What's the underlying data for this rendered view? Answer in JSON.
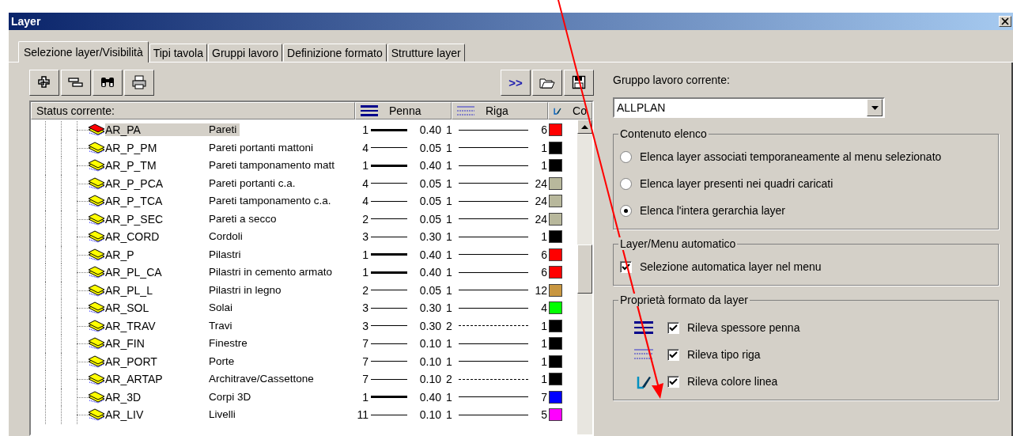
{
  "window": {
    "title": "Layer"
  },
  "tabs": [
    {
      "label": "Selezione layer/Visibilità",
      "selected": true
    },
    {
      "label": "Tipi tavola",
      "selected": false
    },
    {
      "label": "Gruppi lavoro",
      "selected": false
    },
    {
      "label": "Definizione formato",
      "selected": false
    },
    {
      "label": "Strutture layer",
      "selected": false
    }
  ],
  "toolbar_right": {
    "expand_button": ">>"
  },
  "list": {
    "columns": [
      "Status corrente:",
      "Penna",
      "Riga",
      "Co"
    ],
    "rows": [
      {
        "name": "AR_PA",
        "description": "Pareti",
        "pen": "1",
        "thick_pen": true,
        "thickness": "0.40",
        "line": "1",
        "dashed_line": false,
        "color_number": "6",
        "color": "#ff0000",
        "selected": true
      },
      {
        "name": "AR_P_PM",
        "description": "Pareti portanti mattoni",
        "pen": "4",
        "thick_pen": false,
        "thickness": "0.05",
        "line": "1",
        "dashed_line": false,
        "color_number": "1",
        "color": "#000000",
        "selected": false
      },
      {
        "name": "AR_P_TM",
        "description": "Pareti tamponamento matt",
        "pen": "1",
        "thick_pen": true,
        "thickness": "0.40",
        "line": "1",
        "dashed_line": false,
        "color_number": "1",
        "color": "#000000",
        "selected": false
      },
      {
        "name": "AR_P_PCA",
        "description": "Pareti portanti c.a.",
        "pen": "4",
        "thick_pen": false,
        "thickness": "0.05",
        "line": "1",
        "dashed_line": false,
        "color_number": "24",
        "color": "#b8b89c",
        "selected": false
      },
      {
        "name": "AR_P_TCA",
        "description": "Pareti tamponamento c.a.",
        "pen": "4",
        "thick_pen": false,
        "thickness": "0.05",
        "line": "1",
        "dashed_line": false,
        "color_number": "24",
        "color": "#b8b89c",
        "selected": false
      },
      {
        "name": "AR_P_SEC",
        "description": "Pareti a secco",
        "pen": "2",
        "thick_pen": false,
        "thickness": "0.05",
        "line": "1",
        "dashed_line": false,
        "color_number": "24",
        "color": "#b8b89c",
        "selected": false
      },
      {
        "name": "AR_CORD",
        "description": "Cordoli",
        "pen": "3",
        "thick_pen": false,
        "thickness": "0.30",
        "line": "1",
        "dashed_line": false,
        "color_number": "1",
        "color": "#000000",
        "selected": false
      },
      {
        "name": "AR_P",
        "description": "Pilastri",
        "pen": "1",
        "thick_pen": true,
        "thickness": "0.40",
        "line": "1",
        "dashed_line": false,
        "color_number": "6",
        "color": "#ff0000",
        "selected": false
      },
      {
        "name": "AR_PL_CA",
        "description": "Pilastri in cemento armato",
        "pen": "1",
        "thick_pen": true,
        "thickness": "0.40",
        "line": "1",
        "dashed_line": false,
        "color_number": "6",
        "color": "#ff0000",
        "selected": false
      },
      {
        "name": "AR_PL_L",
        "description": "Pilastri in legno",
        "pen": "2",
        "thick_pen": false,
        "thickness": "0.05",
        "line": "1",
        "dashed_line": false,
        "color_number": "12",
        "color": "#c89640",
        "selected": false
      },
      {
        "name": "AR_SOL",
        "description": "Solai",
        "pen": "3",
        "thick_pen": false,
        "thickness": "0.30",
        "line": "1",
        "dashed_line": false,
        "color_number": "4",
        "color": "#00ff00",
        "selected": false
      },
      {
        "name": "AR_TRAV",
        "description": "Travi",
        "pen": "3",
        "thick_pen": false,
        "thickness": "0.30",
        "line": "2",
        "dashed_line": true,
        "color_number": "1",
        "color": "#000000",
        "selected": false
      },
      {
        "name": "AR_FIN",
        "description": "Finestre",
        "pen": "7",
        "thick_pen": false,
        "thickness": "0.10",
        "line": "1",
        "dashed_line": false,
        "color_number": "1",
        "color": "#000000",
        "selected": false
      },
      {
        "name": "AR_PORT",
        "description": "Porte",
        "pen": "7",
        "thick_pen": false,
        "thickness": "0.10",
        "line": "1",
        "dashed_line": false,
        "color_number": "1",
        "color": "#000000",
        "selected": false
      },
      {
        "name": "AR_ARTAP",
        "description": "Architrave/Cassettone",
        "pen": "7",
        "thick_pen": false,
        "thickness": "0.10",
        "line": "2",
        "dashed_line": true,
        "color_number": "1",
        "color": "#000000",
        "selected": false
      },
      {
        "name": "AR_3D",
        "description": "Corpi 3D",
        "pen": "1",
        "thick_pen": true,
        "thickness": "0.40",
        "line": "1",
        "dashed_line": false,
        "color_number": "7",
        "color": "#0000ff",
        "selected": false
      },
      {
        "name": "AR_LIV",
        "description": "Livelli",
        "pen": "11",
        "thick_pen": false,
        "thickness": "0.10",
        "line": "1",
        "dashed_line": false,
        "color_number": "5",
        "color": "#ff00ff",
        "selected": false
      }
    ]
  },
  "work_group": {
    "label": "Gruppo lavoro corrente:",
    "value": "ALLPLAN"
  },
  "list_content": {
    "title": "Contenuto elenco",
    "options": [
      {
        "label": "Elenca layer associati temporaneamente al menu selezionato",
        "selected": false
      },
      {
        "label": "Elenca layer presenti nei quadri caricati",
        "selected": false
      },
      {
        "label": "Elenca l'intera gerarchia layer",
        "selected": true
      }
    ]
  },
  "auto_menu": {
    "title": "Layer/Menu automatico",
    "options": [
      {
        "label": "Selezione automatica layer nel menu",
        "checked": true
      }
    ]
  },
  "format_props": {
    "title": "Proprietà formato da layer",
    "options": [
      {
        "kind": "pen",
        "label": "Rileva spessore penna",
        "checked": true
      },
      {
        "kind": "line",
        "label": "Rileva tipo riga",
        "checked": true
      },
      {
        "kind": "color",
        "label": "Rileva colore linea",
        "checked": true
      }
    ]
  }
}
